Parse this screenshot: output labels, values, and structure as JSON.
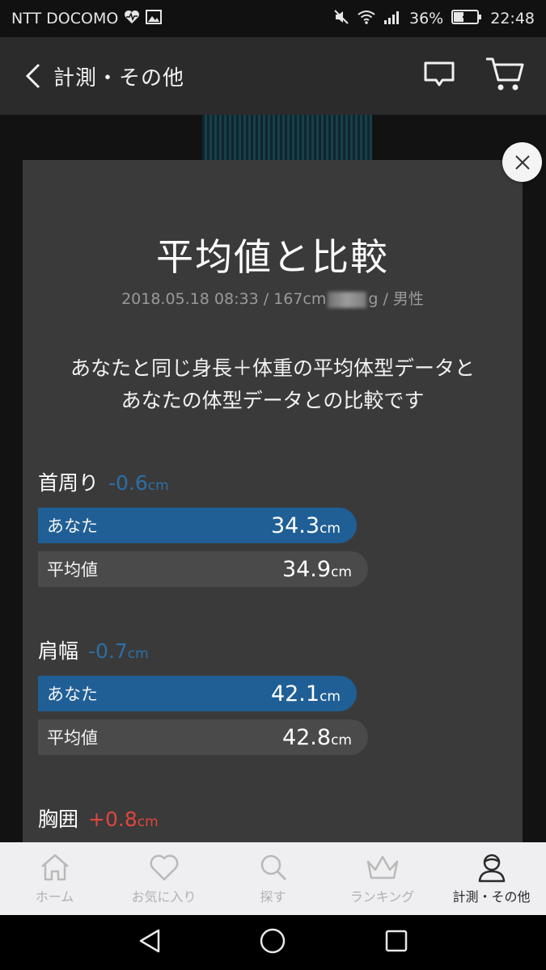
{
  "status_bar": {
    "carrier": "NTT DOCOMO",
    "battery_percent": "36%",
    "time": "22:48"
  },
  "header": {
    "title": "計測・その他"
  },
  "modal": {
    "title": "平均値と比較",
    "subtitle_prefix": "2018.05.18 08:33 / 167cm",
    "subtitle_hidden_tail": "g",
    "subtitle_suffix": " / 男性",
    "description_line1": "あなたと同じ身長＋体重の平均体型データと",
    "description_line2": "あなたの体型データとの比較です",
    "metrics": [
      {
        "label": "首周り",
        "diff": "-0.6",
        "diff_unit": "cm",
        "diff_color": "#2d6fa6",
        "you_label": "あなた",
        "you_value": "34.3",
        "you_unit": "cm",
        "avg_label": "平均値",
        "avg_value": "34.9",
        "avg_unit": "cm"
      },
      {
        "label": "肩幅",
        "diff": "-0.7",
        "diff_unit": "cm",
        "diff_color": "#2d6fa6",
        "you_label": "あなた",
        "you_value": "42.1",
        "you_unit": "cm",
        "avg_label": "平均値",
        "avg_value": "42.8",
        "avg_unit": "cm"
      },
      {
        "label": "胸囲",
        "diff": "+0.8",
        "diff_unit": "cm",
        "diff_color": "#e0453f"
      }
    ]
  },
  "tabbar": {
    "items": [
      {
        "label": "ホーム",
        "icon": "home-icon"
      },
      {
        "label": "お気に入り",
        "icon": "heart-icon"
      },
      {
        "label": "探す",
        "icon": "search-icon"
      },
      {
        "label": "ランキング",
        "icon": "crown-icon"
      },
      {
        "label": "計測・その他",
        "icon": "person-icon",
        "active": true
      }
    ]
  },
  "colors": {
    "you_bar": "#1f5f96",
    "avg_bar": "#4a4a4a",
    "negative_diff": "#2d6fa6",
    "positive_diff": "#e0453f"
  }
}
